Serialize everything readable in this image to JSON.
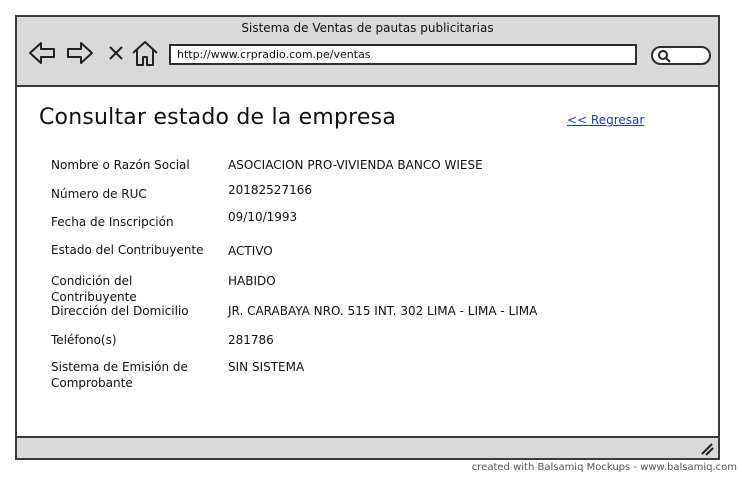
{
  "window": {
    "title": "Sistema de Ventas de pautas publicitarias"
  },
  "browser": {
    "url": "http://www.crpradio.com.pe/ventas",
    "icons": [
      "back-arrow-icon",
      "forward-arrow-icon",
      "close-icon",
      "home-icon",
      "search-icon",
      "resize-grip-icon"
    ]
  },
  "page": {
    "title": "Consultar estado de la empresa",
    "back_link": "<< Regresar",
    "fields": [
      {
        "label": "Nombre o Razón Social",
        "value": "ASOCIACION PRO-VIVIENDA BANCO WIESE"
      },
      {
        "label": "Número de RUC",
        "value": "20182527166"
      },
      {
        "label": "Fecha de  Inscripción",
        "value": "09/10/1993"
      },
      {
        "label": "Estado del Contribuyente",
        "value": "ACTIVO"
      },
      {
        "label": "Condición del Contribuyente",
        "value": "HABIDO"
      },
      {
        "label": "Dirección del Domicilio",
        "value": "JR. CARABAYA NRO. 515 INT. 302 LIMA - LIMA - LIMA"
      },
      {
        "label": "Teléfono(s)",
        "value": "281786"
      },
      {
        "label": "Sistema de Emisión de Comprobante",
        "value": "SIN SISTEMA"
      }
    ]
  },
  "footer": {
    "credit": "created with Balsamiq Mockups - www.balsamiq.com"
  },
  "colors": {
    "chrome": "#d9d9d9",
    "border": "#3a3a3a",
    "link": "#1b3fb8"
  }
}
